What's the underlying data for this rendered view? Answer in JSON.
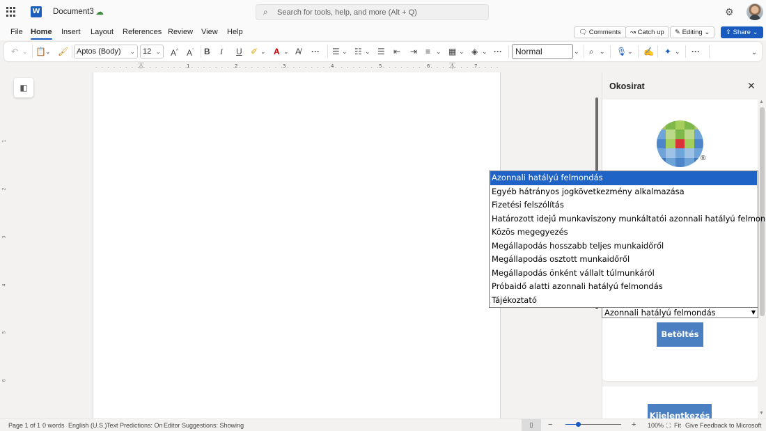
{
  "titlebar": {
    "app_badge": "W",
    "doc_name": "Document3",
    "search_placeholder": "Search for tools, help, and more (Alt + Q)"
  },
  "menu": {
    "tabs": [
      "File",
      "Home",
      "Insert",
      "Layout",
      "References",
      "Review",
      "View",
      "Help"
    ],
    "active_tab": "Home",
    "comments_label": "Comments",
    "catchup_label": "Catch up",
    "editing_label": "Editing",
    "share_label": "Share"
  },
  "ribbon": {
    "font_name": "Aptos (Body)",
    "font_size": "12",
    "style": "Normal"
  },
  "ruler": {
    "numbers": [
      "1",
      "2",
      "3",
      "4",
      "5",
      "6",
      "7"
    ]
  },
  "pane": {
    "title": "Okosirat",
    "registered_mark": "®",
    "selected_value": "Azonnali hatályú felmondás",
    "load_button": "Betöltés",
    "logout_button": "Kijelentkezés",
    "options": [
      "Azonnali hatályú felmondás",
      "Egyéb hátrányos jogkövetkezmény alkalmazása",
      "Fizetési felszólítás",
      "Határozott idejű munkaviszony munkáltatói azonnali hatályú felmondása",
      "Közös megegyezés",
      "Megállapodás hosszabb teljes munkaidőről",
      "Megállapodás osztott munkaidőről",
      "Megállapodás önként vállalt túlmunkáról",
      "Próbaidő alatti azonnali hatályú felmondás",
      "Tájékoztató"
    ],
    "highlighted_index": 0
  },
  "status": {
    "page": "Page 1 of 1",
    "words": "0 words",
    "language": "English (U.S.)",
    "predictions": "Text Predictions: On",
    "editor": "Editor Suggestions: Showing",
    "zoom": "100%",
    "fit": "Fit",
    "feedback": "Give Feedback to Microsoft"
  },
  "colors": {
    "accent": "#185abd",
    "pane_button": "#4a7fc1",
    "list_highlight": "#1f63c7"
  }
}
